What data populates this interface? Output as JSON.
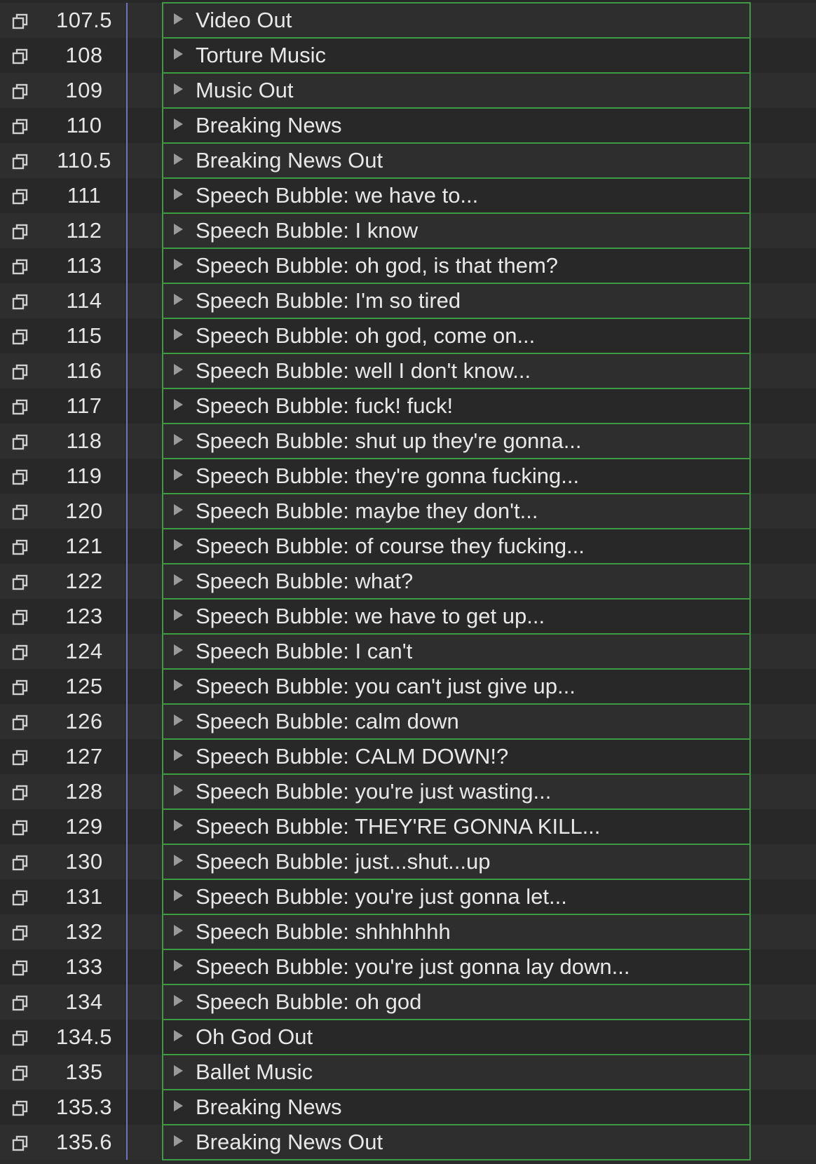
{
  "colors": {
    "background": "#2b2b2c",
    "row_alt": "#282829",
    "cue_border": "#3f9a44",
    "divider": "#6f73b8",
    "text": "#e6e6e6"
  },
  "icons": {
    "row_icon": "copy-icon",
    "disclosure": "disclosure-triangle-icon"
  },
  "cues": [
    {
      "number": "107.5",
      "name": "Video Out"
    },
    {
      "number": "108",
      "name": "Torture Music"
    },
    {
      "number": "109",
      "name": "Music Out"
    },
    {
      "number": "110",
      "name": "Breaking News"
    },
    {
      "number": "110.5",
      "name": "Breaking News Out"
    },
    {
      "number": "111",
      "name": "Speech Bubble: we have to..."
    },
    {
      "number": "112",
      "name": "Speech Bubble: I know"
    },
    {
      "number": "113",
      "name": "Speech Bubble: oh god, is that them?"
    },
    {
      "number": "114",
      "name": "Speech Bubble: I'm so tired"
    },
    {
      "number": "115",
      "name": "Speech Bubble: oh god, come on..."
    },
    {
      "number": "116",
      "name": "Speech Bubble: well I don't know..."
    },
    {
      "number": "117",
      "name": "Speech Bubble: fuck! fuck!"
    },
    {
      "number": "118",
      "name": "Speech Bubble: shut up they're gonna..."
    },
    {
      "number": "119",
      "name": "Speech Bubble: they're gonna fucking..."
    },
    {
      "number": "120",
      "name": "Speech Bubble: maybe they don't..."
    },
    {
      "number": "121",
      "name": "Speech Bubble: of course they fucking..."
    },
    {
      "number": "122",
      "name": "Speech Bubble: what?"
    },
    {
      "number": "123",
      "name": "Speech Bubble: we have to get up..."
    },
    {
      "number": "124",
      "name": "Speech Bubble: I can't"
    },
    {
      "number": "125",
      "name": "Speech Bubble: you can't just give up..."
    },
    {
      "number": "126",
      "name": "Speech Bubble: calm down"
    },
    {
      "number": "127",
      "name": "Speech Bubble: CALM DOWN!?"
    },
    {
      "number": "128",
      "name": "Speech Bubble: you're just wasting..."
    },
    {
      "number": "129",
      "name": "Speech Bubble: THEY'RE GONNA KILL..."
    },
    {
      "number": "130",
      "name": "Speech Bubble: just...shut...up"
    },
    {
      "number": "131",
      "name": "Speech Bubble: you're just gonna let..."
    },
    {
      "number": "132",
      "name": "Speech Bubble: shhhhhhh"
    },
    {
      "number": "133",
      "name": "Speech Bubble: you're just gonna lay down..."
    },
    {
      "number": "134",
      "name": "Speech Bubble: oh god"
    },
    {
      "number": "134.5",
      "name": "Oh God Out"
    },
    {
      "number": "135",
      "name": "Ballet Music"
    },
    {
      "number": "135.3",
      "name": "Breaking News"
    },
    {
      "number": "135.6",
      "name": "Breaking News Out"
    }
  ]
}
